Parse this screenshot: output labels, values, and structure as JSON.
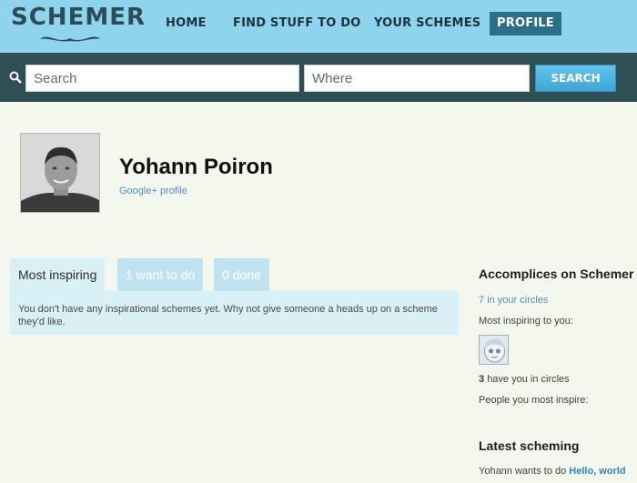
{
  "header": {
    "logo": "SCHEMER",
    "nav": [
      {
        "label": "HOME"
      },
      {
        "label": "FIND STUFF TO DO"
      },
      {
        "label": "YOUR SCHEMES"
      },
      {
        "label": "PROFILE",
        "active": true
      }
    ]
  },
  "search": {
    "what_placeholder": "Search",
    "where_placeholder": "Where",
    "button_label": "SEARCH"
  },
  "profile": {
    "name": "Yohann Poiron",
    "link": "Google+ profile"
  },
  "tabs": [
    {
      "label": "Most inspiring",
      "active": true
    },
    {
      "label": "1 want to do",
      "active": false
    },
    {
      "label": "0 done",
      "active": false
    }
  ],
  "tab_panel": {
    "message": "You don't have any inspirational schemes yet. Why not give someone a heads up on a scheme they'd like."
  },
  "sidebar": {
    "accomplices_title": "Accomplices on Schemer",
    "circles_count": "7",
    "circles_text": "in your circles",
    "most_inspiring_label": "Most inspiring to you:",
    "have_you_count": "3",
    "have_you_text": "have you in circles",
    "people_inspire_label": "People you most inspire:",
    "latest_title": "Latest scheming",
    "latest_prefix": "Yohann wants to do",
    "latest_link": "Hello, world"
  },
  "colors": {
    "header_bg": "#8fd3ec",
    "search_bar_bg": "#2f4f54",
    "accent": "#2e6f88",
    "link": "#4e8fc3",
    "page_bg": "#f4f7ee"
  }
}
